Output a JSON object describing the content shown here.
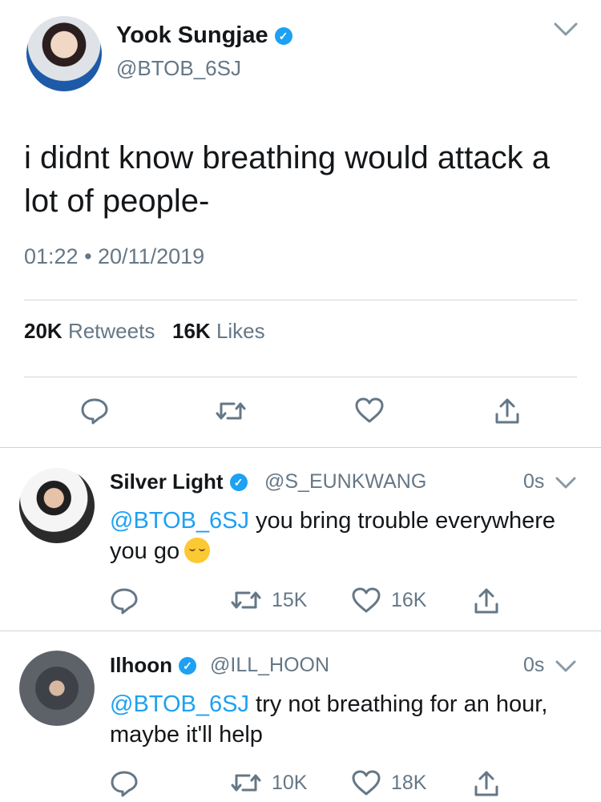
{
  "main_tweet": {
    "author_name": "Yook Sungjae",
    "author_handle": "@BTOB_6SJ",
    "text": "i didnt know breathing would attack a lot of people-",
    "timestamp": "01:22 • 20/11/2019",
    "retweets_count": "20K",
    "retweets_label": "Retweets",
    "likes_count": "16K",
    "likes_label": "Likes"
  },
  "replies": [
    {
      "author_name": "Silver Light",
      "author_handle": "@S_EUNKWANG",
      "time": "0s",
      "mention": "@BTOB_6SJ",
      "text": " you bring trouble everywhere you go",
      "emoji": "pensive-face",
      "retweets": "15K",
      "likes": "16K"
    },
    {
      "author_name": "Ilhoon",
      "author_handle": "@ILL_HOON",
      "time": "0s",
      "mention": "@BTOB_6SJ",
      "text": " try not breathing for an hour, maybe it'll help",
      "retweets": "10K",
      "likes": "18K"
    }
  ],
  "icons": {
    "verified": "verified-badge-icon",
    "reply": "reply-icon",
    "retweet": "retweet-icon",
    "like": "heart-icon",
    "share": "share-icon",
    "more": "chevron-down-icon"
  },
  "colors": {
    "accent": "#1da1f2",
    "text": "#14171a",
    "secondary": "#657786",
    "divider": "#ccd6dd"
  }
}
